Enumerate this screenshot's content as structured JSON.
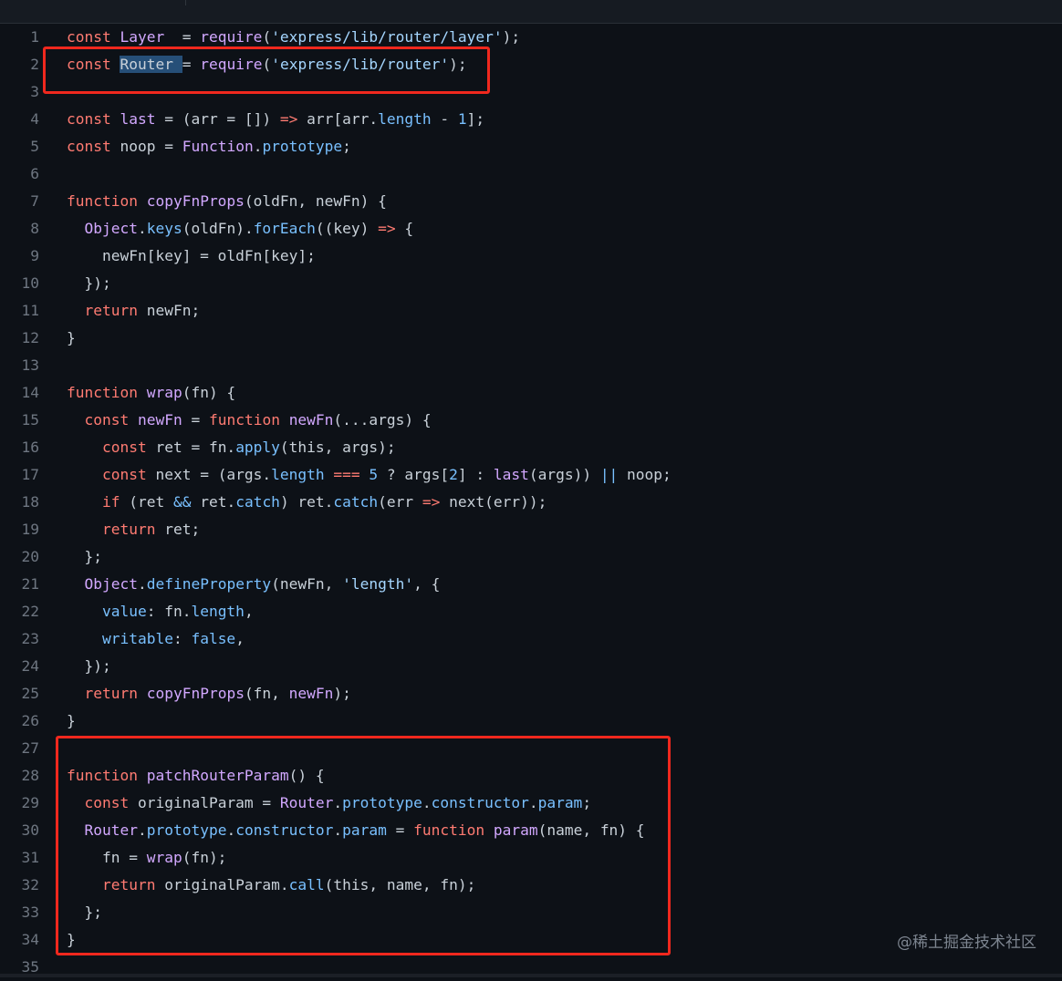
{
  "colors": {
    "background": "#0d1117",
    "keyword": "#ff7b72",
    "function_name": "#d2a8ff",
    "property": "#79c0ff",
    "string": "#a5d6ff",
    "plain": "#c9d1d9",
    "line_number": "#6e7681",
    "highlight_box": "#f0281e",
    "selection": "#264f78"
  },
  "watermark": "@稀土掘金技术社区",
  "lines": [
    {
      "n": "1",
      "tokens": [
        [
          "k",
          "const "
        ],
        [
          "f",
          "Layer"
        ],
        [
          "",
          "  = "
        ],
        [
          "f",
          "require"
        ],
        [
          "",
          "("
        ],
        [
          "s",
          "'express/lib/router/layer'"
        ],
        [
          "",
          ");"
        ]
      ]
    },
    {
      "n": "2",
      "tokens": [
        [
          "k",
          "const "
        ],
        [
          "sel",
          "Router "
        ],
        [
          "",
          "= "
        ],
        [
          "f",
          "require"
        ],
        [
          "",
          "("
        ],
        [
          "s",
          "'express/lib/router'"
        ],
        [
          "",
          ");"
        ]
      ]
    },
    {
      "n": "3",
      "tokens": []
    },
    {
      "n": "4",
      "tokens": [
        [
          "k",
          "const "
        ],
        [
          "f",
          "last"
        ],
        [
          "",
          " = (arr = []) "
        ],
        [
          "o",
          "=>"
        ],
        [
          "",
          " arr[arr."
        ],
        [
          "p",
          "length"
        ],
        [
          "",
          " - "
        ],
        [
          "p",
          "1"
        ],
        [
          "",
          "];"
        ]
      ]
    },
    {
      "n": "5",
      "tokens": [
        [
          "k",
          "const "
        ],
        [
          "",
          "noop = "
        ],
        [
          "f",
          "Function"
        ],
        [
          "",
          "."
        ],
        [
          "p",
          "prototype"
        ],
        [
          "",
          ";"
        ]
      ]
    },
    {
      "n": "6",
      "tokens": []
    },
    {
      "n": "7",
      "tokens": [
        [
          "k",
          "function "
        ],
        [
          "f",
          "copyFnProps"
        ],
        [
          "",
          "(oldFn, newFn) {"
        ]
      ]
    },
    {
      "n": "8",
      "tokens": [
        [
          "",
          "  "
        ],
        [
          "f",
          "Object"
        ],
        [
          "",
          "."
        ],
        [
          "p",
          "keys"
        ],
        [
          "",
          "(oldFn)."
        ],
        [
          "p",
          "forEach"
        ],
        [
          "",
          "((key) "
        ],
        [
          "o",
          "=>"
        ],
        [
          "",
          " {"
        ]
      ]
    },
    {
      "n": "9",
      "tokens": [
        [
          "",
          "    newFn[key] = oldFn[key];"
        ]
      ]
    },
    {
      "n": "10",
      "tokens": [
        [
          "",
          "  });"
        ]
      ]
    },
    {
      "n": "11",
      "tokens": [
        [
          "",
          "  "
        ],
        [
          "k",
          "return "
        ],
        [
          "",
          "newFn;"
        ]
      ]
    },
    {
      "n": "12",
      "tokens": [
        [
          "",
          "}"
        ]
      ]
    },
    {
      "n": "13",
      "tokens": []
    },
    {
      "n": "14",
      "tokens": [
        [
          "k",
          "function "
        ],
        [
          "f",
          "wrap"
        ],
        [
          "",
          "(fn) {"
        ]
      ]
    },
    {
      "n": "15",
      "tokens": [
        [
          "",
          "  "
        ],
        [
          "k",
          "const "
        ],
        [
          "f",
          "newFn"
        ],
        [
          "",
          " = "
        ],
        [
          "k",
          "function "
        ],
        [
          "f",
          "newFn"
        ],
        [
          "",
          "(...args) {"
        ]
      ]
    },
    {
      "n": "16",
      "tokens": [
        [
          "",
          "    "
        ],
        [
          "k",
          "const "
        ],
        [
          "",
          "ret = fn."
        ],
        [
          "p",
          "apply"
        ],
        [
          "",
          "(this, args);"
        ]
      ]
    },
    {
      "n": "17",
      "tokens": [
        [
          "",
          "    "
        ],
        [
          "k",
          "const "
        ],
        [
          "",
          "next = (args."
        ],
        [
          "p",
          "length"
        ],
        [
          "",
          " "
        ],
        [
          "o",
          "==="
        ],
        [
          "",
          " "
        ],
        [
          "p",
          "5"
        ],
        [
          "",
          " ? args["
        ],
        [
          "p",
          "2"
        ],
        [
          "",
          "] : "
        ],
        [
          "f",
          "last"
        ],
        [
          "",
          "(args)) "
        ],
        [
          "p",
          "||"
        ],
        [
          "",
          " noop;"
        ]
      ]
    },
    {
      "n": "18",
      "tokens": [
        [
          "",
          "    "
        ],
        [
          "k",
          "if "
        ],
        [
          "",
          "(ret "
        ],
        [
          "p",
          "&&"
        ],
        [
          "",
          " ret."
        ],
        [
          "p",
          "catch"
        ],
        [
          "",
          ") ret."
        ],
        [
          "p",
          "catch"
        ],
        [
          "",
          "(err "
        ],
        [
          "o",
          "=>"
        ],
        [
          "",
          " next(err));"
        ]
      ]
    },
    {
      "n": "19",
      "tokens": [
        [
          "",
          "    "
        ],
        [
          "k",
          "return "
        ],
        [
          "",
          "ret;"
        ]
      ]
    },
    {
      "n": "20",
      "tokens": [
        [
          "",
          "  };"
        ]
      ]
    },
    {
      "n": "21",
      "tokens": [
        [
          "",
          "  "
        ],
        [
          "f",
          "Object"
        ],
        [
          "",
          "."
        ],
        [
          "p",
          "defineProperty"
        ],
        [
          "",
          "(newFn, "
        ],
        [
          "s",
          "'length'"
        ],
        [
          "",
          ", {"
        ]
      ]
    },
    {
      "n": "22",
      "tokens": [
        [
          "",
          "    "
        ],
        [
          "p",
          "value"
        ],
        [
          "",
          ": fn."
        ],
        [
          "p",
          "length"
        ],
        [
          "",
          ","
        ]
      ]
    },
    {
      "n": "23",
      "tokens": [
        [
          "",
          "    "
        ],
        [
          "p",
          "writable"
        ],
        [
          "",
          ": "
        ],
        [
          "p",
          "false"
        ],
        [
          "",
          ","
        ]
      ]
    },
    {
      "n": "24",
      "tokens": [
        [
          "",
          "  });"
        ]
      ]
    },
    {
      "n": "25",
      "tokens": [
        [
          "",
          "  "
        ],
        [
          "k",
          "return "
        ],
        [
          "f",
          "copyFnProps"
        ],
        [
          "",
          "(fn, "
        ],
        [
          "f",
          "newFn"
        ],
        [
          "",
          ");"
        ]
      ]
    },
    {
      "n": "26",
      "tokens": [
        [
          "",
          "}"
        ]
      ]
    },
    {
      "n": "27",
      "tokens": []
    },
    {
      "n": "28",
      "tokens": [
        [
          "k",
          "function "
        ],
        [
          "f",
          "patchRouterParam"
        ],
        [
          "",
          "() {"
        ]
      ]
    },
    {
      "n": "29",
      "tokens": [
        [
          "",
          "  "
        ],
        [
          "k",
          "const "
        ],
        [
          "",
          "originalParam = "
        ],
        [
          "f",
          "Router"
        ],
        [
          "",
          "."
        ],
        [
          "p",
          "prototype"
        ],
        [
          "",
          "."
        ],
        [
          "p",
          "constructor"
        ],
        [
          "",
          "."
        ],
        [
          "p",
          "param"
        ],
        [
          "",
          ";"
        ]
      ]
    },
    {
      "n": "30",
      "tokens": [
        [
          "",
          "  "
        ],
        [
          "f",
          "Router"
        ],
        [
          "",
          "."
        ],
        [
          "p",
          "prototype"
        ],
        [
          "",
          "."
        ],
        [
          "p",
          "constructor"
        ],
        [
          "",
          "."
        ],
        [
          "p",
          "param"
        ],
        [
          "",
          " = "
        ],
        [
          "k",
          "function "
        ],
        [
          "f",
          "param"
        ],
        [
          "",
          "(name, fn) {"
        ]
      ]
    },
    {
      "n": "31",
      "tokens": [
        [
          "",
          "    fn = "
        ],
        [
          "f",
          "wrap"
        ],
        [
          "",
          "(fn);"
        ]
      ]
    },
    {
      "n": "32",
      "tokens": [
        [
          "",
          "    "
        ],
        [
          "k",
          "return "
        ],
        [
          "",
          "originalParam."
        ],
        [
          "p",
          "call"
        ],
        [
          "",
          "(this, name, fn);"
        ]
      ]
    },
    {
      "n": "33",
      "tokens": [
        [
          "",
          "  };"
        ]
      ]
    },
    {
      "n": "34",
      "tokens": [
        [
          "",
          "}"
        ]
      ]
    },
    {
      "n": "35",
      "tokens": []
    }
  ]
}
